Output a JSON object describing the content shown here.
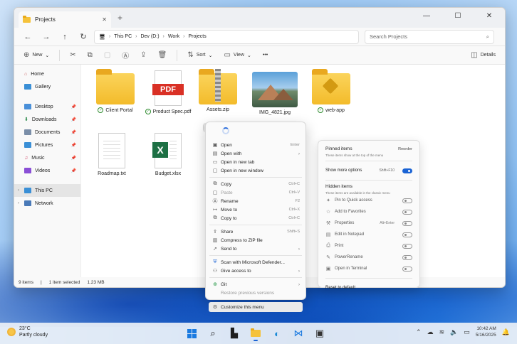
{
  "window": {
    "tab_title": "Projects",
    "controls": {
      "minimize": "—",
      "maximize": "☐",
      "close": "✕"
    }
  },
  "breadcrumb": [
    "This PC",
    "Dev (D:)",
    "Work",
    "Projects"
  ],
  "search": {
    "placeholder": "Search Projects"
  },
  "toolbar": {
    "new": "New",
    "sort": "Sort",
    "view": "View",
    "more": "•••",
    "details": "Details"
  },
  "sidebar": {
    "top": [
      {
        "label": "Home"
      },
      {
        "label": "Gallery"
      }
    ],
    "pinned": [
      {
        "label": "Desktop"
      },
      {
        "label": "Downloads"
      },
      {
        "label": "Documents"
      },
      {
        "label": "Pictures"
      },
      {
        "label": "Music"
      },
      {
        "label": "Videos"
      }
    ],
    "drives": [
      {
        "label": "This PC"
      },
      {
        "label": "Network"
      }
    ]
  },
  "files": [
    {
      "name": "Client Portal",
      "type": "folder",
      "synced": true
    },
    {
      "name": "Product Spec.pdf",
      "type": "pdf",
      "synced": true,
      "badge": "PDF"
    },
    {
      "name": "Assets.zip",
      "type": "zip",
      "synced": false
    },
    {
      "name": "IMG_4821.jpg",
      "type": "image",
      "synced": false
    },
    {
      "name": "web-app",
      "type": "folder",
      "synced": true
    },
    {
      "name": "Roadmap.txt",
      "type": "txt",
      "synced": false
    },
    {
      "name": "Budget.xlsx",
      "type": "xlsx",
      "synced": false,
      "badge": "X"
    }
  ],
  "status": {
    "count": "9 items",
    "selection": "1 item selected",
    "size": "1.23 MB"
  },
  "context_menu": {
    "groups": [
      [
        {
          "label": "Open",
          "shortcut": "Enter"
        },
        {
          "label": "Open with",
          "submenu": true
        },
        {
          "label": "Open in new tab"
        },
        {
          "label": "Open in new window"
        }
      ],
      [
        {
          "label": "Copy",
          "shortcut": "Ctrl+C"
        },
        {
          "label": "Paste",
          "shortcut": "Ctrl+V",
          "disabled": true
        },
        {
          "label": "Rename",
          "shortcut": "F2"
        },
        {
          "label": "Move to",
          "shortcut": "Ctrl+X"
        },
        {
          "label": "Copy to",
          "shortcut": "Ctrl+C"
        }
      ],
      [
        {
          "label": "Share",
          "shortcut": "Shift+S"
        },
        {
          "label": "Compress to ZIP file"
        },
        {
          "label": "Send to",
          "submenu": true
        }
      ],
      [
        {
          "label": "Scan with Microsoft Defender..."
        },
        {
          "label": "Give access to",
          "submenu": true
        }
      ],
      [
        {
          "label": "Git",
          "submenu": true
        },
        {
          "label": "Restore previous versions",
          "disabled": true
        }
      ]
    ],
    "customize": "Customize this menu"
  },
  "customize_panel": {
    "pinned_title": "Pinned items",
    "pinned_desc": "These items show at the top of the menu",
    "reorder": "Reorder",
    "show_more": {
      "label": "Show more options",
      "shortcut": "Shift+F10",
      "on": true
    },
    "hidden_title": "Hidden items",
    "hidden_desc": "These items are available in the classic menu",
    "hidden": [
      {
        "label": "Pin to Quick access"
      },
      {
        "label": "Add to Favorites"
      },
      {
        "label": "Properties",
        "shortcut": "Alt+Enter"
      },
      {
        "label": "Edit in Notepad"
      },
      {
        "label": "Print"
      },
      {
        "label": "PowerRename"
      },
      {
        "label": "Open in Terminal"
      }
    ],
    "reset": "Reset to default"
  },
  "taskbar": {
    "weather": {
      "temp": "23°C",
      "condition": "Partly cloudy"
    },
    "clock": {
      "time": "10:42 AM",
      "date": "5/16/2025"
    }
  },
  "colors": {
    "accent": "#1a63d4",
    "folder": "#f5c23b",
    "pdf": "#d93025",
    "excel": "#1d7044"
  }
}
